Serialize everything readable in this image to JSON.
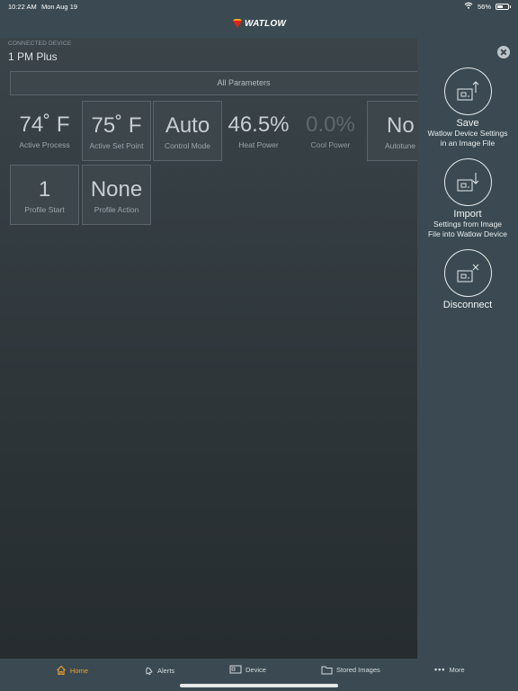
{
  "status": {
    "time": "10:22 AM",
    "date": "Mon Aug 19",
    "battery": "56%",
    "battery_level": 0.56
  },
  "brand": {
    "logo_text": "WATLOW",
    "accent": "#e2231a"
  },
  "device": {
    "label": "CONNECTED DEVICE",
    "name": "1 PM Plus"
  },
  "all_params_label": "All Parameters",
  "tiles": [
    {
      "value": "74˚ F",
      "label": "Active Process"
    },
    {
      "value": "75˚ F",
      "label": "Active Set Point"
    },
    {
      "value": "Auto",
      "label": "Control Mode"
    },
    {
      "value": "46.5%",
      "label": "Heat Power"
    },
    {
      "value": "0.0%",
      "label": "Cool Power"
    },
    {
      "value": "No",
      "label": "Autotune"
    },
    {
      "value": "1",
      "label": "Profile Start"
    },
    {
      "value": "None",
      "label": "Profile Action"
    }
  ],
  "sidebar": {
    "save": {
      "title": "Save",
      "desc1": "Watlow Device Settings",
      "desc2": "in an Image File"
    },
    "import": {
      "title": "Import",
      "desc1": "Settings from Image",
      "desc2": "File into Watlow Device"
    },
    "disconnect": {
      "title": "Disconnect"
    }
  },
  "tabs": [
    {
      "label": "Home",
      "icon": "home-icon"
    },
    {
      "label": "Alerts",
      "icon": "bell-icon"
    },
    {
      "label": "Device",
      "icon": "device-icon"
    },
    {
      "label": "Stored Images",
      "icon": "folder-icon"
    },
    {
      "label": "More",
      "icon": "ellipsis-icon"
    }
  ],
  "colors": {
    "active_tab": "#f0a22b",
    "panel": "#3b4a52"
  }
}
